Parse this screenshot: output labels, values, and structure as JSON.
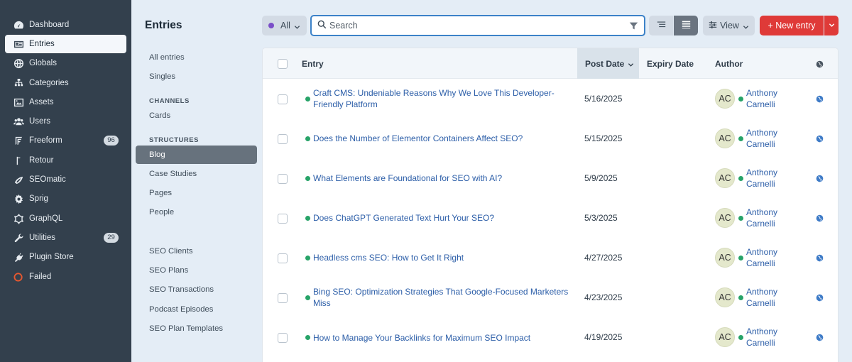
{
  "nav": {
    "items": [
      {
        "label": "Dashboard",
        "icon": "gauge-icon"
      },
      {
        "label": "Entries",
        "icon": "newspaper-icon",
        "active": true
      },
      {
        "label": "Globals",
        "icon": "globe-icon"
      },
      {
        "label": "Categories",
        "icon": "sitemap-icon"
      },
      {
        "label": "Assets",
        "icon": "image-icon"
      },
      {
        "label": "Users",
        "icon": "users-icon"
      },
      {
        "label": "Freeform",
        "icon": "freeform-icon",
        "badge": "96"
      },
      {
        "label": "Retour",
        "icon": "retour-icon"
      },
      {
        "label": "SEOmatic",
        "icon": "seomatic-icon"
      },
      {
        "label": "Sprig",
        "icon": "sprig-icon"
      },
      {
        "label": "GraphQL",
        "icon": "graphql-icon"
      },
      {
        "label": "Utilities",
        "icon": "wrench-icon",
        "badge": "29"
      },
      {
        "label": "Plugin Store",
        "icon": "plug-icon"
      },
      {
        "label": "Failed",
        "icon": "circle-icon"
      }
    ]
  },
  "sources": {
    "title": "Entries",
    "all_entries": "All entries",
    "singles": "Singles",
    "channels_heading": "CHANNELS",
    "cards": "Cards",
    "structures_heading": "STRUCTURES",
    "blog": "Blog",
    "case_studies": "Case Studies",
    "pages": "Pages",
    "people": "People",
    "seo_clients": "SEO Clients",
    "seo_plans": "SEO Plans",
    "seo_transactions": "SEO Transactions",
    "podcast_episodes": "Podcast Episodes",
    "seo_plan_templates": "SEO Plan Templates"
  },
  "toolbar": {
    "status_label": "All",
    "search_placeholder": "Search",
    "view_label": "View",
    "new_entry_label": "+ New entry"
  },
  "table": {
    "headers": {
      "entry": "Entry",
      "post_date": "Post Date",
      "expiry_date": "Expiry Date",
      "author": "Author"
    },
    "rows": [
      {
        "title": "Craft CMS: Undeniable Reasons Why We Love This Developer-Friendly Platform",
        "post_date": "5/16/2025",
        "initials": "AC",
        "author": "Anthony Carnelli",
        "status": "live"
      },
      {
        "title": "Does the Number of Elementor Containers Affect SEO?",
        "post_date": "5/15/2025",
        "initials": "AC",
        "author": "Anthony Carnelli",
        "status": "live"
      },
      {
        "title": "What Elements are Foundational for SEO with AI?",
        "post_date": "5/9/2025",
        "initials": "AC",
        "author": "Anthony Carnelli",
        "status": "live"
      },
      {
        "title": "Does ChatGPT Generated Text Hurt Your SEO?",
        "post_date": "5/3/2025",
        "initials": "AC",
        "author": "Anthony Carnelli",
        "status": "live"
      },
      {
        "title": "Headless cms SEO: How to Get It Right",
        "post_date": "4/27/2025",
        "initials": "AC",
        "author": "Anthony Carnelli",
        "status": "live"
      },
      {
        "title": "Bing SEO: Optimization Strategies That Google-Focused Marketers Miss",
        "post_date": "4/23/2025",
        "initials": "AC",
        "author": "Anthony Carnelli",
        "status": "live"
      },
      {
        "title": "How to Manage Your Backlinks for Maximum SEO Impact",
        "post_date": "4/19/2025",
        "initials": "AC",
        "author": "Anthony Carnelli",
        "status": "live"
      }
    ]
  },
  "colors": {
    "nav_bg": "#33404d",
    "accent_red": "#df3a38",
    "link_blue": "#2c5ea8",
    "status_green": "#27a368",
    "status_all_purple": "#7a4ec8"
  }
}
